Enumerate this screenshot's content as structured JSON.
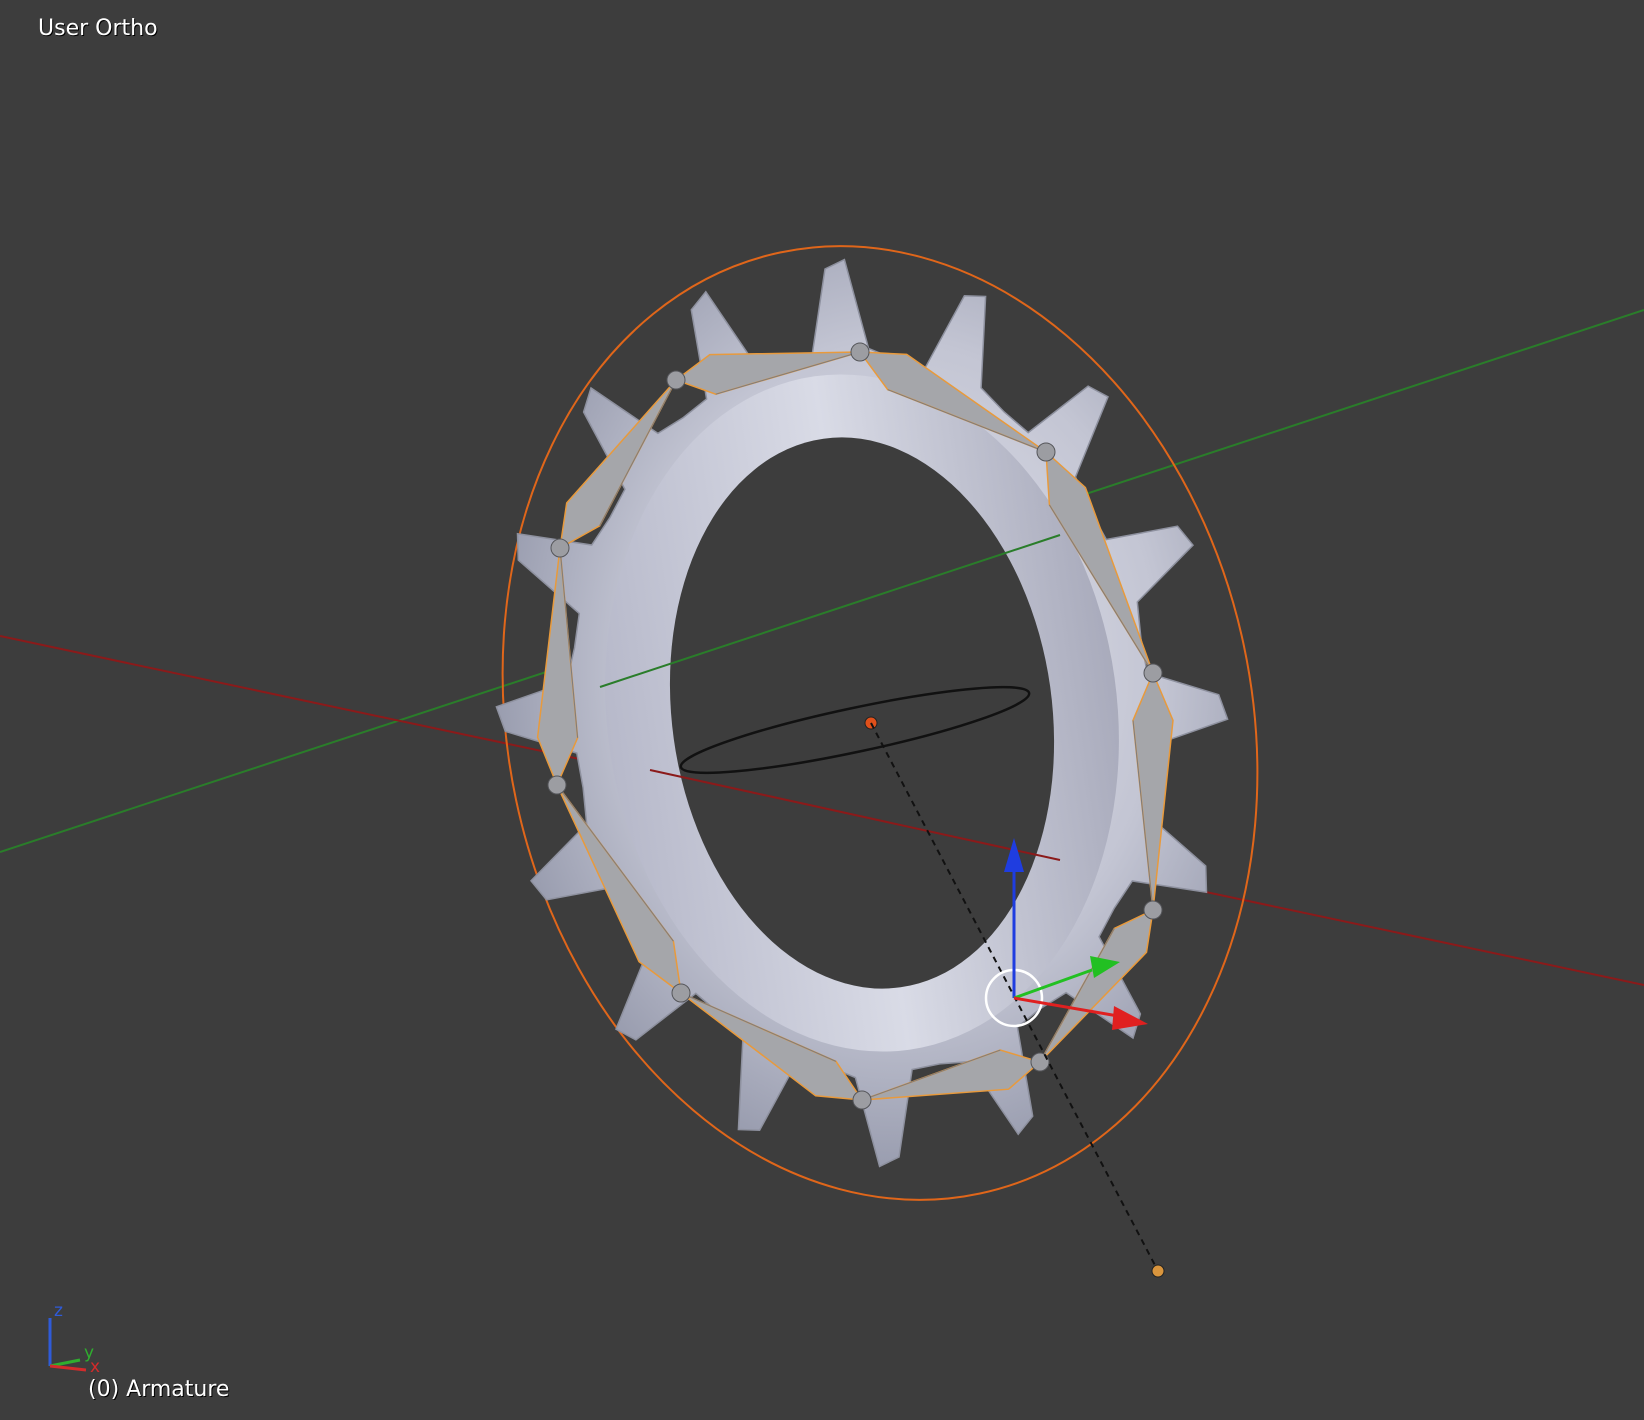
{
  "viewport": {
    "view_label": "User Ortho",
    "object_info": "(0) Armature"
  },
  "axis_gizmo": {
    "labels": {
      "x": "x",
      "y": "y",
      "z": "z"
    },
    "colors": {
      "x": "#d32b2b",
      "y": "#2fae2f",
      "z": "#2f5bd9"
    }
  },
  "scene": {
    "colors": {
      "background": "#3d3d3d",
      "x_axis_line": "#8b1a1a",
      "y_axis_line": "#2a7d2a",
      "gear": "#c9cbd6",
      "gear_shade": "#9ea1ad",
      "bone": "#a5a6aa",
      "bone_outline": "#e89a3c",
      "selection_circle": "#e0661a",
      "lamp": "#111111",
      "gizmo_x": "#e02020",
      "gizmo_y": "#22c022",
      "gizmo_z": "#1f3de0"
    },
    "icons": [
      "sun-lamp-icon",
      "transform-gizmo-icon",
      "axis-gizmo-icon",
      "3d-cursor-icon"
    ]
  }
}
